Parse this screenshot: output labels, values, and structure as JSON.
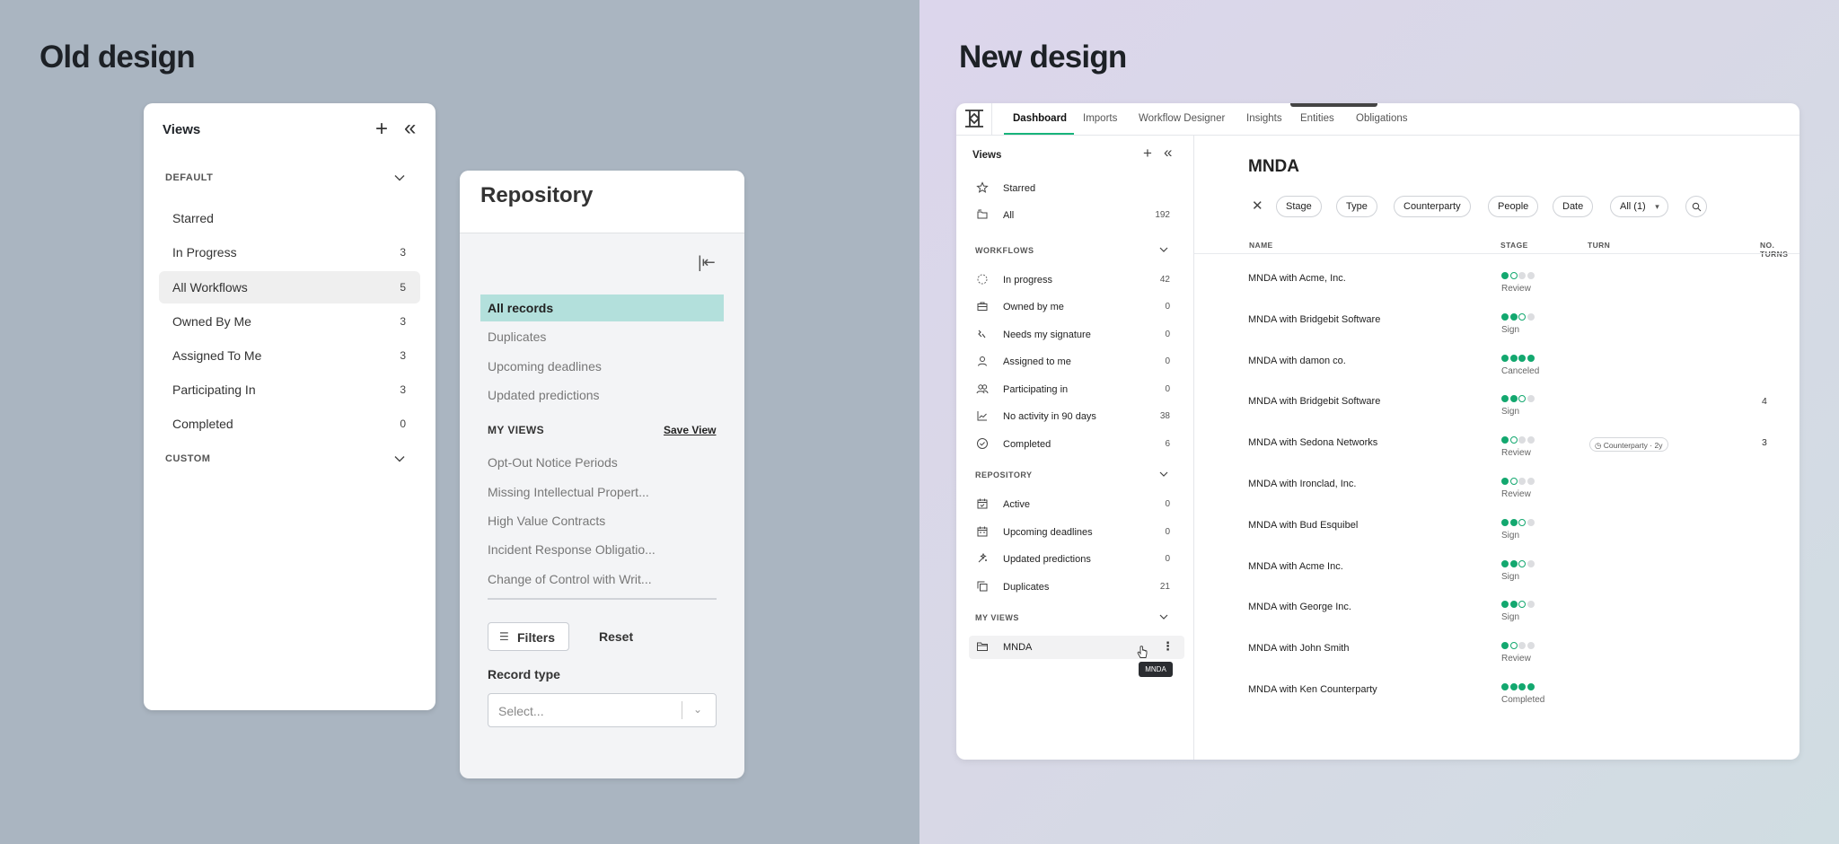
{
  "headings": {
    "old": "Old design",
    "new": "New design"
  },
  "old_views": {
    "title": "Views",
    "sections": {
      "default": "DEFAULT",
      "custom": "CUSTOM"
    },
    "items": [
      {
        "label": "Starred",
        "count": ""
      },
      {
        "label": "In Progress",
        "count": "3"
      },
      {
        "label": "All Workflows",
        "count": "5"
      },
      {
        "label": "Owned By Me",
        "count": "3"
      },
      {
        "label": "Assigned To Me",
        "count": "3"
      },
      {
        "label": "Participating In",
        "count": "3"
      },
      {
        "label": "Completed",
        "count": "0"
      }
    ]
  },
  "repository": {
    "title": "Repository",
    "items": [
      "All records",
      "Duplicates",
      "Upcoming deadlines",
      "Updated predictions"
    ],
    "my_views_label": "MY VIEWS",
    "save_view": "Save View",
    "views": [
      "Opt-Out Notice Periods",
      "Missing Intellectual Propert...",
      "High Value Contracts",
      "Incident Response Obligatio...",
      "Change of Control with Writ..."
    ],
    "filters_label": "Filters",
    "reset_label": "Reset",
    "record_type_label": "Record type",
    "select_placeholder": "Select..."
  },
  "app": {
    "tabs": [
      "Dashboard",
      "Imports",
      "Workflow Designer",
      "Insights",
      "Entities",
      "Obligations"
    ],
    "active_tab": "Dashboard",
    "sidebar": {
      "title": "Views",
      "top_items": [
        {
          "label": "Starred",
          "count": "",
          "icon": "star-icon"
        },
        {
          "label": "All",
          "count": "192",
          "icon": "folders-icon"
        }
      ],
      "workflows_label": "WORKFLOWS",
      "workflows": [
        {
          "label": "In progress",
          "count": "42",
          "icon": "dashed-circle-icon"
        },
        {
          "label": "Owned by me",
          "count": "0",
          "icon": "briefcase-icon"
        },
        {
          "label": "Needs my signature",
          "count": "0",
          "icon": "signature-icon"
        },
        {
          "label": "Assigned to me",
          "count": "0",
          "icon": "user-icon"
        },
        {
          "label": "Participating in",
          "count": "0",
          "icon": "users-icon"
        },
        {
          "label": "No activity in 90 days",
          "count": "38",
          "icon": "chart-line-icon"
        },
        {
          "label": "Completed",
          "count": "6",
          "icon": "check-circle-icon"
        }
      ],
      "repository_label": "REPOSITORY",
      "repository": [
        {
          "label": "Active",
          "count": "0",
          "icon": "calendar-check-icon"
        },
        {
          "label": "Upcoming deadlines",
          "count": "0",
          "icon": "calendar-icon"
        },
        {
          "label": "Updated predictions",
          "count": "0",
          "icon": "sparkle-icon"
        },
        {
          "label": "Duplicates",
          "count": "21",
          "icon": "copy-icon"
        }
      ],
      "my_views_label": "MY VIEWS",
      "my_views": [
        {
          "label": "MNDA",
          "icon": "folder-icon"
        }
      ],
      "tooltip": "MNDA"
    },
    "main": {
      "title": "MNDA",
      "filters": [
        "Stage",
        "Type",
        "Counterparty",
        "People",
        "Date",
        "All (1)"
      ],
      "columns": {
        "name": "NAME",
        "stage": "STAGE",
        "turn": "TURN",
        "turns": "NO. TURNS"
      },
      "rows": [
        {
          "name": "MNDA with Acme, Inc.",
          "dots": "foee",
          "stage": "Review",
          "turn": "",
          "turns": ""
        },
        {
          "name": "MNDA with Bridgebit Software",
          "dots": "ffoe",
          "stage": "Sign",
          "turn": "",
          "turns": ""
        },
        {
          "name": "MNDA with damon co.",
          "dots": "ffff",
          "stage": "Canceled",
          "turn": "",
          "turns": ""
        },
        {
          "name": "MNDA with Bridgebit Software",
          "dots": "ffoe",
          "stage": "Sign",
          "turn": "",
          "turns": "4"
        },
        {
          "name": "MNDA with Sedona Networks",
          "dots": "foee",
          "stage": "Review",
          "turn": "Counterparty · 2y",
          "turns": "3"
        },
        {
          "name": "MNDA with Ironclad, Inc.",
          "dots": "foee",
          "stage": "Review",
          "turn": "",
          "turns": ""
        },
        {
          "name": "MNDA with Bud Esquibel",
          "dots": "ffoe",
          "stage": "Sign",
          "turn": "",
          "turns": ""
        },
        {
          "name": "MNDA with Acme Inc.",
          "dots": "ffoe",
          "stage": "Sign",
          "turn": "",
          "turns": ""
        },
        {
          "name": "MNDA with George Inc.",
          "dots": "ffoe",
          "stage": "Sign",
          "turn": "",
          "turns": ""
        },
        {
          "name": "MNDA with John Smith",
          "dots": "foee",
          "stage": "Review",
          "turn": "",
          "turns": ""
        },
        {
          "name": "MNDA with Ken Counterparty",
          "dots": "ffff",
          "stage": "Completed",
          "turn": "",
          "turns": ""
        }
      ]
    }
  },
  "colors": {
    "accent": "#13a86f",
    "repo_selected": "#b3e0dc",
    "left_bg": "#aab5c1"
  }
}
